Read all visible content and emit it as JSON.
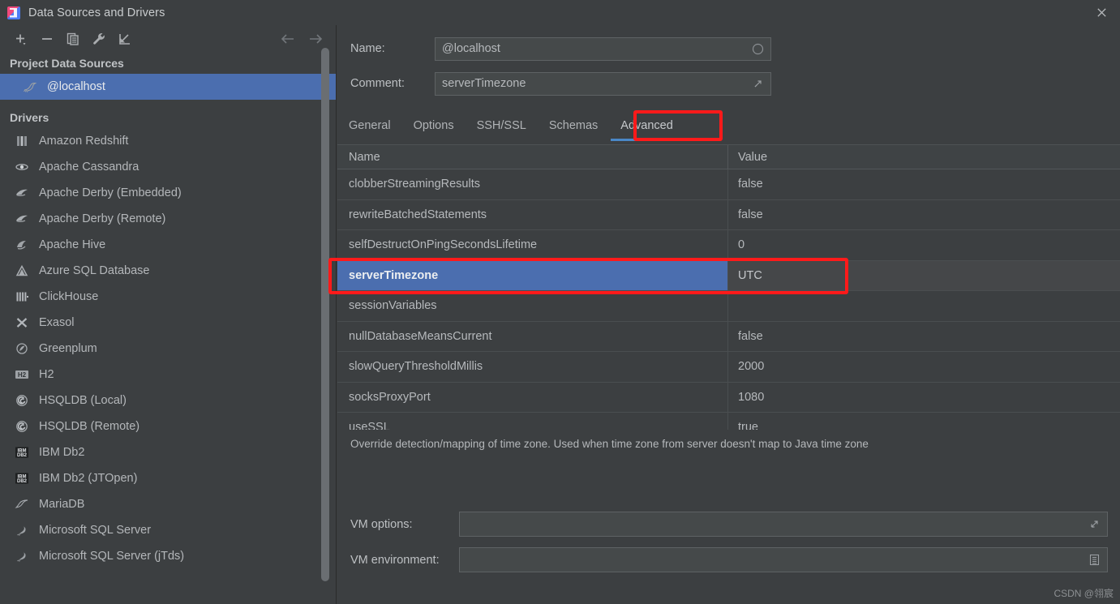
{
  "window": {
    "title": "Data Sources and Drivers",
    "app_icon": "datagrip-icon",
    "close_label": "×"
  },
  "left_panel": {
    "toolbar": [
      {
        "name": "add-button",
        "icon": "plus-icon",
        "label": "+"
      },
      {
        "name": "remove-button",
        "icon": "minus-icon",
        "label": "−"
      },
      {
        "name": "copy-button",
        "icon": "copy-icon",
        "label": "copy"
      },
      {
        "name": "properties-button",
        "icon": "wrench-icon",
        "label": "wrench"
      },
      {
        "name": "import-button",
        "icon": "import-arrow-icon",
        "label": "import"
      }
    ],
    "nav": [
      {
        "name": "back-button",
        "icon": "arrow-left-icon",
        "label": "←"
      },
      {
        "name": "forward-button",
        "icon": "arrow-right-icon",
        "label": "→"
      }
    ],
    "project_group_label": "Project Data Sources",
    "data_sources": [
      {
        "label": "@localhost",
        "icon": "mysql-dolphin-icon",
        "selected": true
      }
    ],
    "drivers_group_label": "Drivers",
    "drivers": [
      {
        "label": "Amazon Redshift",
        "icon": "redshift-icon"
      },
      {
        "label": "Apache Cassandra",
        "icon": "cassandra-icon"
      },
      {
        "label": "Apache Derby (Embedded)",
        "icon": "derby-icon"
      },
      {
        "label": "Apache Derby (Remote)",
        "icon": "derby-icon"
      },
      {
        "label": "Apache Hive",
        "icon": "hive-icon"
      },
      {
        "label": "Azure SQL Database",
        "icon": "azure-icon"
      },
      {
        "label": "ClickHouse",
        "icon": "clickhouse-icon"
      },
      {
        "label": "Exasol",
        "icon": "exasol-icon"
      },
      {
        "label": "Greenplum",
        "icon": "greenplum-icon"
      },
      {
        "label": "H2",
        "icon": "h2-icon"
      },
      {
        "label": "HSQLDB (Local)",
        "icon": "hsqldb-icon"
      },
      {
        "label": "HSQLDB (Remote)",
        "icon": "hsqldb-icon"
      },
      {
        "label": "IBM Db2",
        "icon": "db2-icon"
      },
      {
        "label": "IBM Db2 (JTOpen)",
        "icon": "db2-icon"
      },
      {
        "label": "MariaDB",
        "icon": "mariadb-icon"
      },
      {
        "label": "Microsoft SQL Server",
        "icon": "mssql-icon"
      },
      {
        "label": "Microsoft SQL Server (jTds)",
        "icon": "mssql-icon"
      }
    ]
  },
  "right_panel": {
    "name_label": "Name:",
    "name_value": "@localhost",
    "comment_label": "Comment:",
    "comment_value": "serverTimezone",
    "tabs": [
      {
        "label": "General",
        "active": false
      },
      {
        "label": "Options",
        "active": false
      },
      {
        "label": "SSH/SSL",
        "active": false
      },
      {
        "label": "Schemas",
        "active": false
      },
      {
        "label": "Advanced",
        "active": true
      }
    ],
    "table": {
      "columns": [
        "Name",
        "Value"
      ],
      "rows": [
        {
          "name": "clobberStreamingResults",
          "value": "false",
          "selected": false
        },
        {
          "name": "rewriteBatchedStatements",
          "value": "false",
          "selected": false
        },
        {
          "name": "selfDestructOnPingSecondsLifetime",
          "value": "0",
          "selected": false
        },
        {
          "name": "serverTimezone",
          "value": "UTC",
          "selected": true
        },
        {
          "name": "sessionVariables",
          "value": "",
          "selected": false
        },
        {
          "name": "nullDatabaseMeansCurrent",
          "value": "false",
          "selected": false
        },
        {
          "name": "slowQueryThresholdMillis",
          "value": "2000",
          "selected": false
        },
        {
          "name": "socksProxyPort",
          "value": "1080",
          "selected": false
        },
        {
          "name": "useSSL",
          "value": "true",
          "selected": false
        }
      ]
    },
    "description": "Override detection/mapping of time zone. Used when time zone from server doesn't map to Java time zone",
    "vm_options_label": "VM options:",
    "vm_options_value": "",
    "vm_environment_label": "VM environment:",
    "vm_environment_value": ""
  },
  "annotations": {
    "accent_red": "#ff1a1a",
    "selection_blue": "#4b6eaf",
    "tab_underline_blue": "#4a88c7"
  },
  "watermark": "CSDN @翎宸"
}
